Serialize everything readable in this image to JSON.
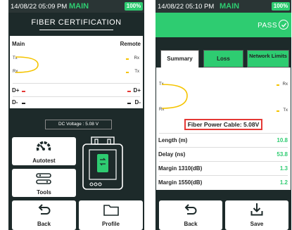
{
  "left": {
    "status": {
      "time": "14/08/22 05:09 PM",
      "mode": "MAIN",
      "battery": "100%"
    },
    "title": "FIBER CERTIFICATION",
    "panel": {
      "main_label": "Main",
      "remote_label": "Remote",
      "tx": "Tx",
      "rx": "Rx",
      "d_plus": "D+",
      "d_minus": "D-"
    },
    "voltage": "DC Voltage : 5.08 V",
    "buttons": {
      "autotest": "Autotest",
      "tools": "Tools",
      "back": "Back",
      "profile": "Profile"
    }
  },
  "right": {
    "status": {
      "time": "14/08/22 05:10 PM",
      "mode": "MAIN",
      "battery": "100%"
    },
    "result": "PASS",
    "tabs": [
      {
        "label": "Summary"
      },
      {
        "label": "Loss"
      },
      {
        "label": "Network Limits"
      }
    ],
    "panel": {
      "tx": "Tx",
      "rx": "Rx",
      "cable": "Fiber Power Cable: 5.08V"
    },
    "rows": [
      {
        "label": "Length (m)",
        "value": "10.8"
      },
      {
        "label": "Delay (ns)",
        "value": "53.8"
      },
      {
        "label": "Margin 1310(dB)",
        "value": "1.3"
      },
      {
        "label": "Margin 1550(dB)",
        "value": "1.2"
      }
    ],
    "buttons": {
      "back": "Back",
      "save": "Save"
    }
  },
  "colors": {
    "accent": "#2ecc71",
    "background": "#1d2a2a",
    "highlight": "#e53935",
    "signal": "#f5c400"
  }
}
